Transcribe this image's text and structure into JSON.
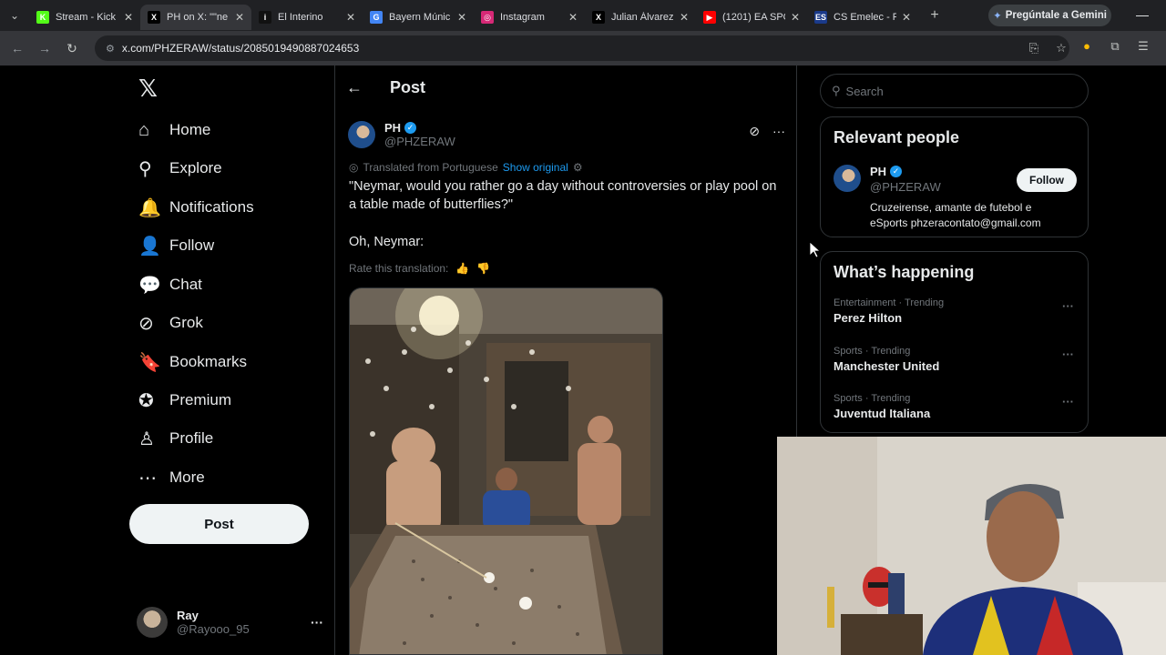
{
  "browser": {
    "tabs": [
      {
        "label": "Stream - Kick",
        "color": "#53fc18",
        "glyph": "K"
      },
      {
        "label": "PH on X: \"\"ne",
        "color": "#000000",
        "glyph": "X",
        "active": true
      },
      {
        "label": "El Interino",
        "color": "#111111",
        "glyph": "i"
      },
      {
        "label": "Bayern Múnic",
        "color": "#4285f4",
        "glyph": "G"
      },
      {
        "label": "Instagram",
        "color": "#d62976",
        "glyph": "◎"
      },
      {
        "label": "Julian Álvarez",
        "color": "#000000",
        "glyph": "X"
      },
      {
        "label": "(1201) EA SPO",
        "color": "#ff0000",
        "glyph": "▶"
      },
      {
        "label": "CS Emelec - F",
        "color": "#1a3a8a",
        "glyph": "ES"
      }
    ],
    "gemini_label": "Pregúntale a Gemini",
    "url": "x.com/PHZERAW/status/2085019490887024653"
  },
  "nav": {
    "items": [
      {
        "label": "Home",
        "icon": "home-icon",
        "glyph": "⌂"
      },
      {
        "label": "Explore",
        "icon": "search-icon",
        "glyph": "⚲"
      },
      {
        "label": "Notifications",
        "icon": "bell-icon",
        "glyph": "🔔"
      },
      {
        "label": "Follow",
        "icon": "follow-icon",
        "glyph": "👤"
      },
      {
        "label": "Chat",
        "icon": "chat-icon",
        "glyph": "💬"
      },
      {
        "label": "Grok",
        "icon": "grok-icon",
        "glyph": "⊘"
      },
      {
        "label": "Bookmarks",
        "icon": "bookmark-icon",
        "glyph": "🔖"
      },
      {
        "label": "Premium",
        "icon": "premium-icon",
        "glyph": "✪"
      },
      {
        "label": "Profile",
        "icon": "profile-icon",
        "glyph": "♙"
      },
      {
        "label": "More",
        "icon": "more-icon",
        "glyph": "⋯"
      }
    ],
    "post_label": "Post",
    "account": {
      "name": "Ray",
      "handle": "@Rayooo_95"
    }
  },
  "post": {
    "heading": "Post",
    "author_name": "PH",
    "author_handle": "@PHZERAW",
    "translated_label": "Translated from Portuguese",
    "show_original": "Show original",
    "text_line1": "\"Neymar, would you rather go a day without controversies or play pool on a table made of butterflies?\"",
    "text_line2": "Oh, Neymar:",
    "rate_label": "Rate this translation:"
  },
  "sidebar": {
    "search_placeholder": "Search",
    "relevant_title": "Relevant people",
    "person": {
      "name": "PH",
      "handle": "@PHZERAW",
      "bio": "Cruzeirense, amante de futebol e eSports phzeracontato@gmail.com",
      "follow_label": "Follow"
    },
    "happening_title": "What’s happening",
    "trends": [
      {
        "context": "Entertainment · Trending",
        "name": "Perez Hilton"
      },
      {
        "context": "Sports · Trending",
        "name": "Manchester United"
      },
      {
        "context": "Sports · Trending",
        "name": "Juventud Italiana"
      }
    ]
  },
  "colors": {
    "accent": "#1d9bf0",
    "background": "#000000",
    "border": "#2f3336"
  }
}
